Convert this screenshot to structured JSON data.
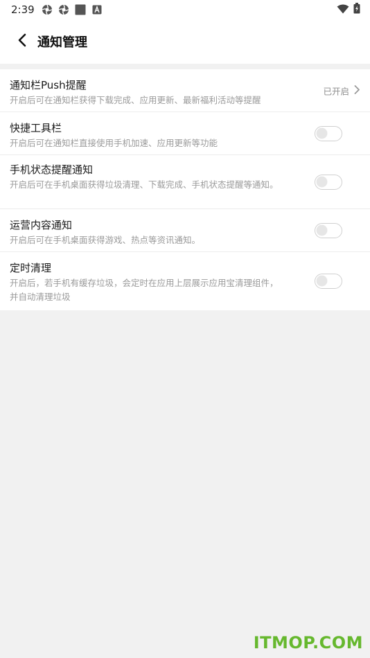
{
  "status_bar": {
    "time": "2:39",
    "icons_left": [
      "aperture-icon",
      "aperture-icon",
      "square-icon",
      "a-badge-icon"
    ],
    "icons_right": [
      "wifi-icon",
      "battery-charging-icon"
    ]
  },
  "header": {
    "title": "通知管理",
    "back_icon": "chevron-left-icon"
  },
  "settings": [
    {
      "title": "通知栏Push提醒",
      "description": "开启后可在通知栏获得下载完成、应用更新、最新福利活动等提醒",
      "value": "已开启",
      "control": "chevron"
    },
    {
      "title": "快捷工具栏",
      "description": "开启后可在通知栏直接使用手机加速、应用更新等功能",
      "control": "toggle",
      "enabled": false
    },
    {
      "title": "手机状态提醒通知",
      "description": "开启后可在手机桌面获得垃圾清理、下载完成、手机状态提醒等通知。",
      "control": "toggle",
      "enabled": false
    },
    {
      "title": "运营内容通知",
      "description": "开启后可在手机桌面获得游戏、热点等资讯通知。",
      "control": "toggle",
      "enabled": false
    },
    {
      "title": "定时清理",
      "description": "开启后，若手机有缓存垃圾，会定时在应用上层展示应用宝清理组件，并自动清理垃圾",
      "control": "toggle",
      "enabled": false
    }
  ],
  "watermark": "ITMOP.COM",
  "colors": {
    "background": "#f1f1f1",
    "surface": "#ffffff",
    "watermark": "#66b82e",
    "toggle_off": "#cfcfcf"
  }
}
